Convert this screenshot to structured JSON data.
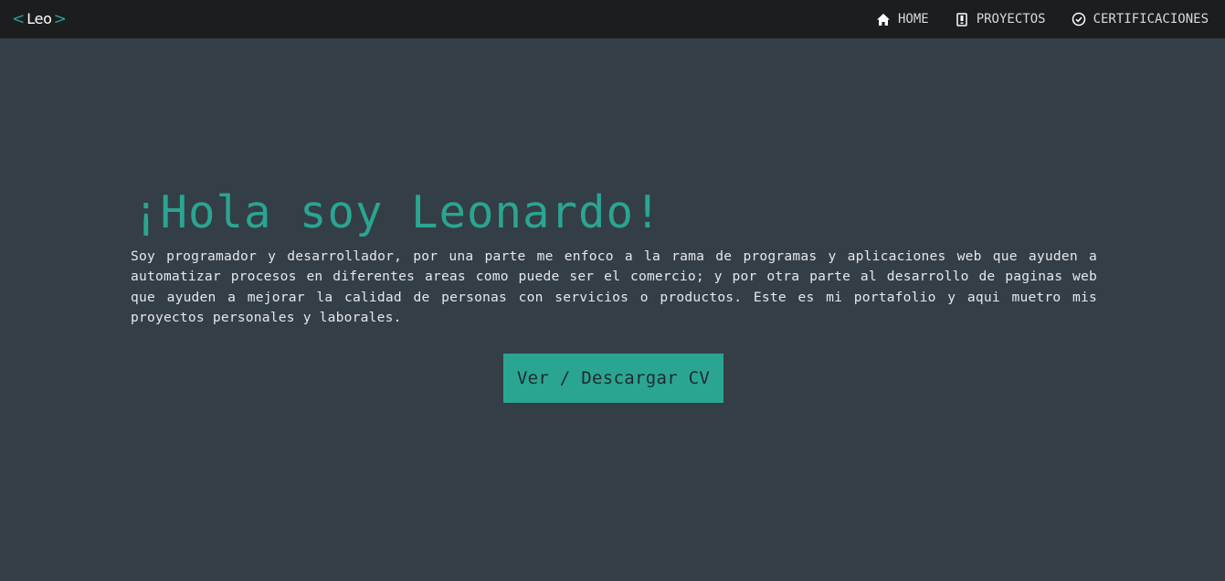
{
  "brand": {
    "left_chevron": "<",
    "name": "Leo",
    "right_chevron": ">"
  },
  "nav": {
    "items": [
      {
        "label": "HOME",
        "icon": "home-icon"
      },
      {
        "label": "PROYECTOS",
        "icon": "project-icon"
      },
      {
        "label": "CERTIFICACIONES",
        "icon": "check-circle-icon"
      }
    ]
  },
  "hero": {
    "title": "¡Hola soy Leonardo!",
    "description": "Soy programador y desarrollador, por una parte me enfoco a la rama de programas y aplicaciones web que ayuden a automatizar procesos en diferentes areas como puede ser el comercio; y por otra parte al desarrollo de paginas web que ayuden a mejorar la calidad de personas con servicios o productos. Este es mi portafolio y aqui muetro mis proyectos personales y laborales.",
    "cv_button": "Ver / Descargar CV"
  },
  "colors": {
    "accent": "#2aa592",
    "navbar_bg": "#1c1d1f",
    "page_bg": "#343e46",
    "text_light": "#e6e7e8"
  }
}
